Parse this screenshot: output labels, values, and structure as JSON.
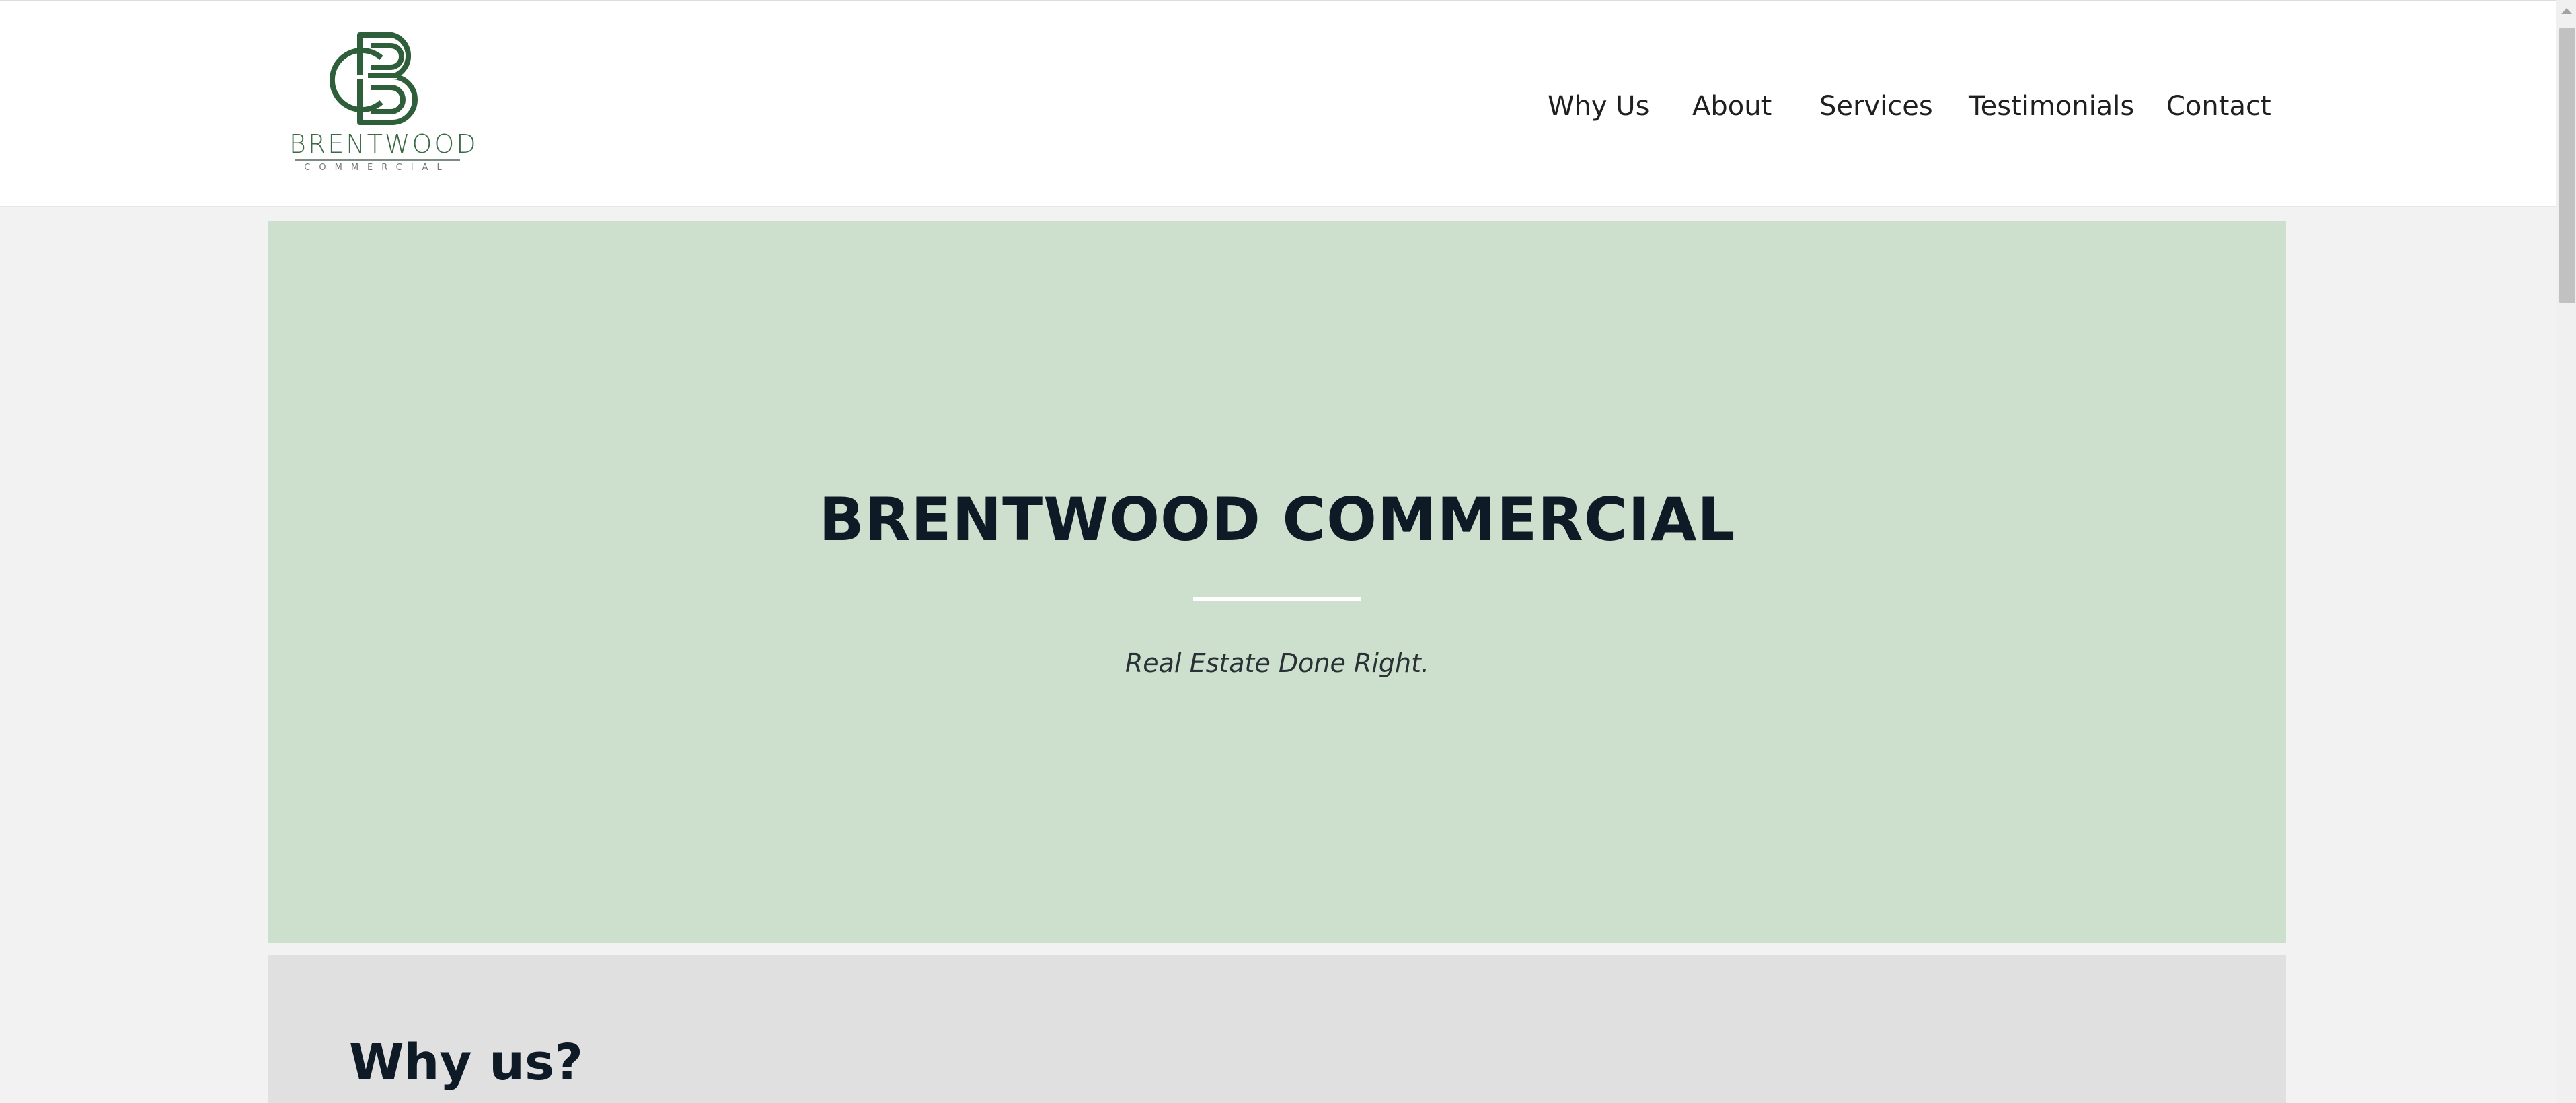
{
  "brand": {
    "name": "BRENTWOOD",
    "subname": "COMMERCIAL",
    "logo_icon": "brentwood-monogram-icon",
    "logo_color": "#2f5e3a"
  },
  "nav": {
    "items": [
      {
        "label": "Why Us"
      },
      {
        "label": "About"
      },
      {
        "label": "Services"
      },
      {
        "label": "Testimonials"
      },
      {
        "label": "Contact"
      }
    ]
  },
  "hero": {
    "title": "BRENTWOOD COMMERCIAL",
    "tagline": "Real Estate Done Right.",
    "background_color": "#cde0cd"
  },
  "why_section": {
    "heading": "Why us?"
  },
  "colors": {
    "page_background": "#f2f2f2",
    "heading_text": "#0e1a26",
    "section_background": "#e0e0e0"
  }
}
